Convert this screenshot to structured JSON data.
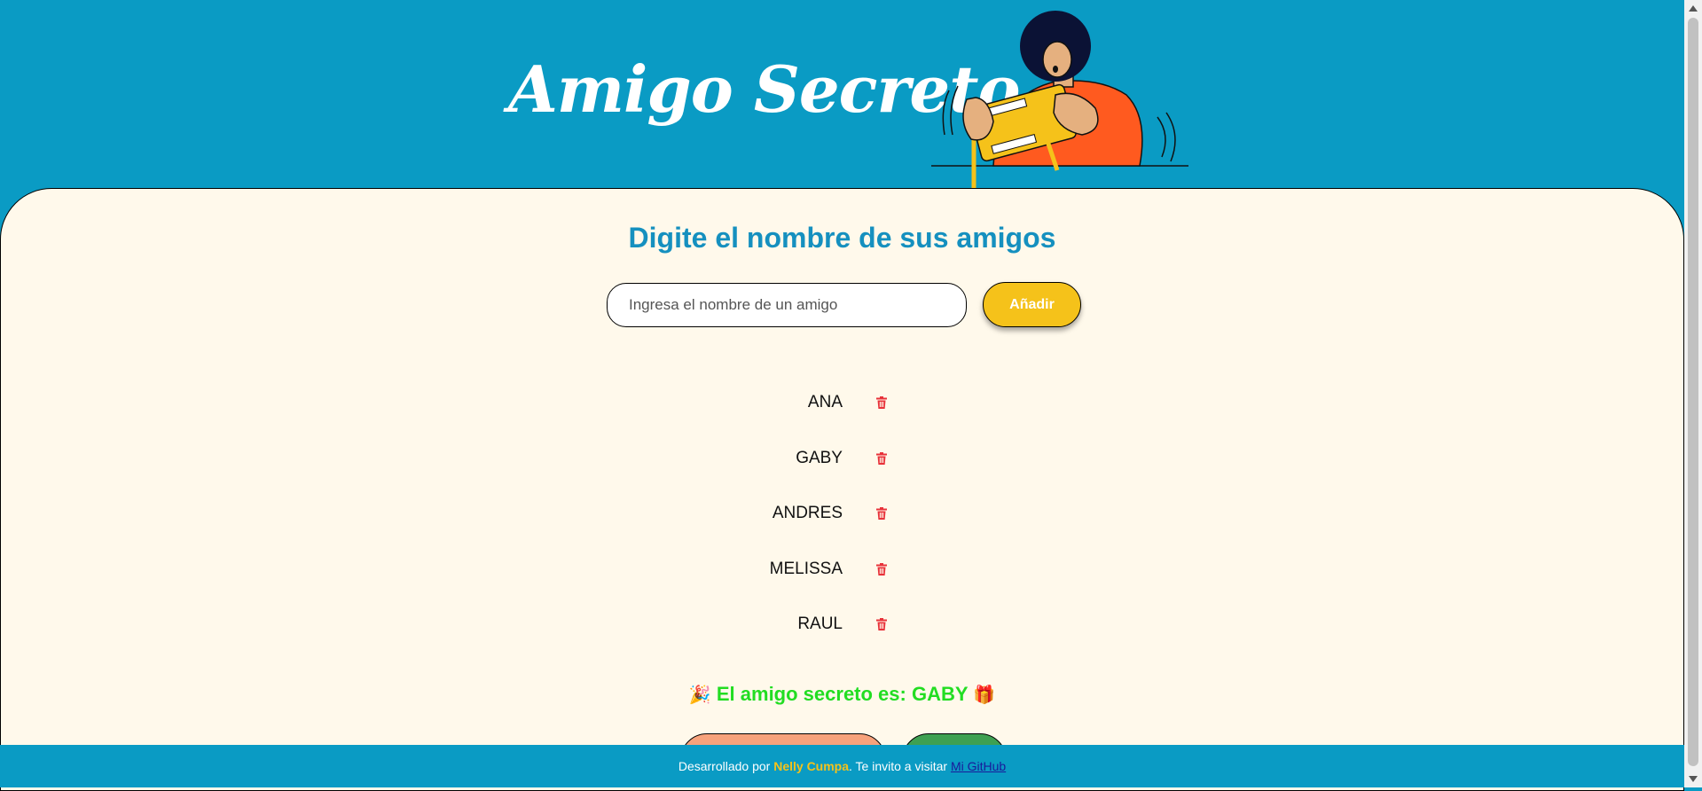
{
  "header": {
    "title": "Amigo Secreto"
  },
  "main": {
    "heading": "Digite el nombre de sus amigos",
    "input": {
      "placeholder": "Ingresa el nombre de un amigo",
      "value": ""
    },
    "add_button": "Añadir",
    "friends": [
      {
        "name": "ANA"
      },
      {
        "name": "GABY"
      },
      {
        "name": "ANDRES"
      },
      {
        "name": "MELISSA"
      },
      {
        "name": "RAUL"
      }
    ],
    "result": {
      "prefix_emoji": "🎉",
      "text": "El amigo secreto es: GABY",
      "suffix_emoji": "🎁"
    }
  },
  "footer": {
    "prefix": "Desarrollado por ",
    "author": "Nelly Cumpa",
    "middle": ". Te invito a visitar ",
    "link": "Mi GitHub"
  },
  "colors": {
    "header_bg": "#0a9bc4",
    "card_bg": "#fff9eb",
    "heading": "#1590bf",
    "add_button": "#f5c21a",
    "result_text": "#22dd22",
    "trash": "#e8323a",
    "reset_button": "#f7a27c",
    "draw_button": "#3ea052"
  },
  "icons": {
    "delete": "trash-icon"
  }
}
